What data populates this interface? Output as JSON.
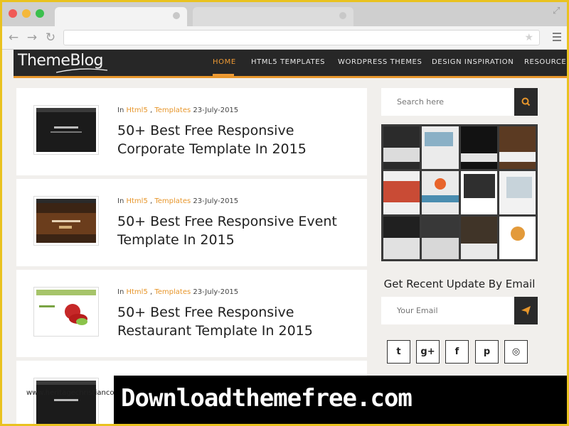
{
  "browser": {
    "address": ""
  },
  "site": {
    "logo_text": "ThemeBlog",
    "menu": [
      {
        "label": "HOME",
        "active": true
      },
      {
        "label": "HTML5 TEMPLATES",
        "active": false
      },
      {
        "label": "WORDPRESS THEMES",
        "active": false
      },
      {
        "label": "DESIGN INSPIRATION",
        "active": false
      },
      {
        "label": "RESOURCE",
        "active": false
      }
    ],
    "accent_color": "#e7962b"
  },
  "posts": [
    {
      "in": "In",
      "cat1": "Html5",
      "sep": ",",
      "cat2": "Templates",
      "date": "23-July-2015",
      "title": "50+ Best Free Responsive Corporate Template In 2015"
    },
    {
      "in": "In",
      "cat1": "Html5",
      "sep": ",",
      "cat2": "Templates",
      "date": "23-July-2015",
      "title": "50+ Best Free Responsive Event Template In 2015"
    },
    {
      "in": "In",
      "cat1": "Html5",
      "sep": ",",
      "cat2": "Templates",
      "date": "23-July-2015",
      "title": "50+ Best Free Responsive Restaurant Template In 2015"
    }
  ],
  "sidebar": {
    "search_placeholder": "Search here",
    "newsletter_title": "Get Recent Update By Email",
    "email_placeholder": "Your Email",
    "social_icons": [
      "twitter-icon",
      "google-plus-icon",
      "facebook-icon",
      "pinterest-icon",
      "instagram-icon"
    ],
    "social_glyphs": [
      "t",
      "g+",
      "f",
      "p",
      "◎"
    ]
  },
  "watermark": {
    "large": "Downloadthemefree.com",
    "small": "www.heritagechristiancollege.com"
  }
}
